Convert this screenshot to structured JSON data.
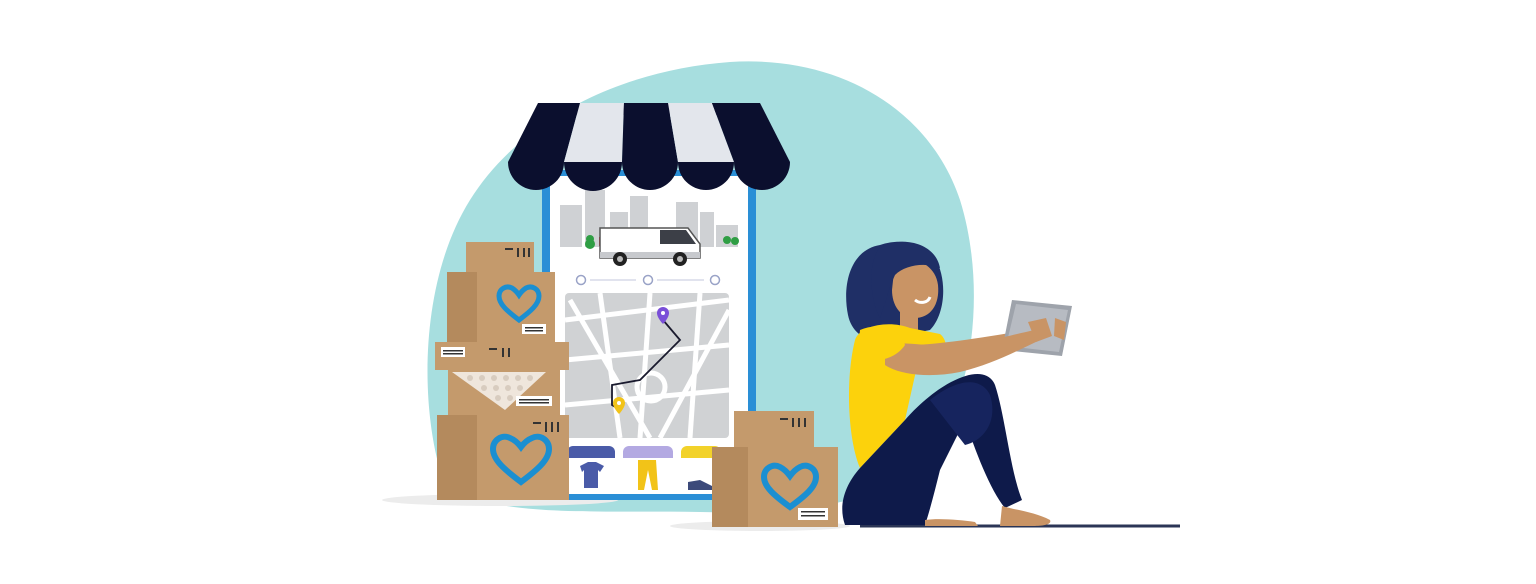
{
  "colors": {
    "background": "#ffffff",
    "blob": "#a7dedf",
    "awning_dark": "#0b0f2e",
    "awning_light": "#e3e6ec",
    "phone_frame": "#2a8fd6",
    "screen": "#ffffff",
    "map_bg": "#d0d2d4",
    "map_roads": "#ffffff",
    "route": "#1a1a2e",
    "pin_purple": "#7a4fd8",
    "pin_yellow": "#f2c318",
    "box": "#c49a6c",
    "box_shade": "#a8805a",
    "heart": "#1b8fd1",
    "shirt_yellow": "#fcd20c",
    "pants_navy": "#0e1a4a",
    "hair": "#1f2f66",
    "skin": "#c99465",
    "tablet": "#9ea3ab",
    "van": "#ffffff",
    "ground_line": "#2b3556",
    "shadow": "#ececec"
  },
  "icons": {
    "package": "cardboard-box-heart-logo",
    "map_pin_start": "map-pin-icon",
    "map_pin_end": "map-pin-icon",
    "delivery_van": "delivery-van-icon",
    "progress_check": "check-circle-icon",
    "shop_awning": "awning-icon",
    "fragile_symbols": "handling-symbols-icon"
  },
  "shop_categories": [
    "shirt",
    "pants",
    "shoes"
  ],
  "progress_steps": 3
}
